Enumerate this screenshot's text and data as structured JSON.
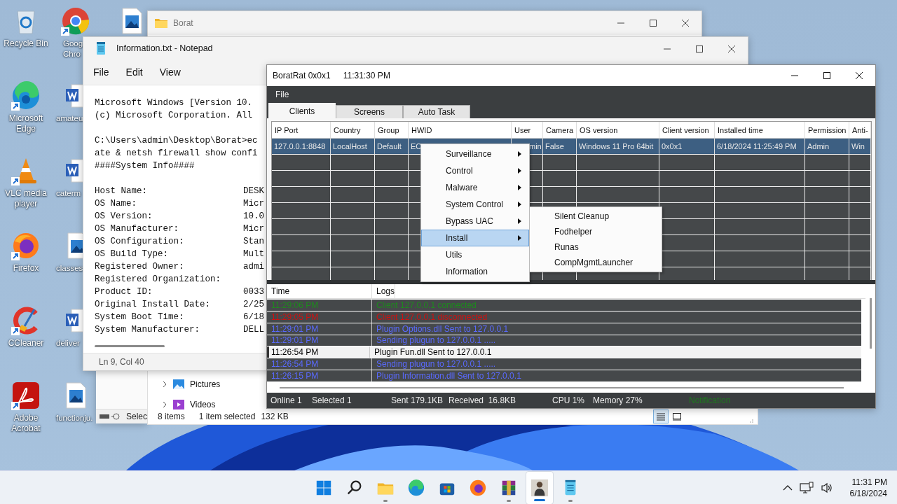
{
  "desktop_icons": [
    {
      "label": "Recycle Bin",
      "kind": "recycle_bin",
      "shortcut": false
    },
    {
      "label": "Goog Chro",
      "kind": "chrome",
      "shortcut": true
    },
    {
      "label": "Microsoft Edge",
      "kind": "edge",
      "shortcut": true
    },
    {
      "label": "amateu",
      "kind": "word",
      "shortcut": false
    },
    {
      "label": "VLC media player",
      "kind": "vlc",
      "shortcut": true
    },
    {
      "label": "caterm",
      "kind": "word",
      "shortcut": false
    },
    {
      "label": "Firefox",
      "kind": "firefox",
      "shortcut": true
    },
    {
      "label": "classes",
      "kind": "image",
      "shortcut": false
    },
    {
      "label": "CCleaner",
      "kind": "ccleaner",
      "shortcut": true
    },
    {
      "label": "deliver",
      "kind": "word",
      "shortcut": false
    },
    {
      "label": "Adobe Acrobat",
      "kind": "acrobat",
      "shortcut": true
    },
    {
      "label": "functionju.",
      "kind": "image",
      "shortcut": false
    }
  ],
  "hidden_desktop_icon": {
    "kind": "image"
  },
  "explorer": {
    "title": "Borat",
    "nav": [
      {
        "label": "Pictures",
        "kind": "pictures"
      },
      {
        "label": "Videos",
        "kind": "videos"
      }
    ],
    "status": {
      "items": "8 items",
      "selected": "1 item selected",
      "size": "132 KB"
    },
    "views": [
      {
        "kind": "details",
        "selected": true
      },
      {
        "kind": "tiles",
        "selected": false
      }
    ]
  },
  "back_window": {
    "status": "Selec"
  },
  "notepad": {
    "title": "Information.txt - Notepad",
    "menu": [
      "File",
      "Edit",
      "View"
    ],
    "paragraphs": [
      [
        "Microsoft Windows [Version 10.",
        "(c) Microsoft Corporation. All"
      ],
      [
        "C:\\Users\\admin\\Desktop\\Borat>ec",
        "ate & netsh firewall show confi",
        "####System Info####"
      ]
    ],
    "info": [
      {
        "label": "Host Name:",
        "value": "DESK"
      },
      {
        "label": "OS Name:",
        "value": "Micr"
      },
      {
        "label": "OS Version:",
        "value": "10.0"
      },
      {
        "label": "OS Manufacturer:",
        "value": "Micr"
      },
      {
        "label": "OS Configuration:",
        "value": "Stan"
      },
      {
        "label": "OS Build Type:",
        "value": "Mult"
      },
      {
        "label": "Registered Owner:",
        "value": "admi"
      },
      {
        "label": "Registered Organization:"
      },
      {
        "label": "Product ID:",
        "value": "0033"
      },
      {
        "label": "Original Install Date:",
        "value": "2/25"
      },
      {
        "label": "System Boot Time:",
        "value": "6/18"
      },
      {
        "label": "System Manufacturer:",
        "value": "DELL"
      }
    ],
    "status": "Ln 9, Col 40"
  },
  "boratrat": {
    "title": "BoratRat 0x0x1",
    "clock": "11:31:30 PM",
    "menu": [
      "File"
    ],
    "tabs": [
      {
        "label": "Clients",
        "selected": true
      },
      {
        "label": "Screens",
        "selected": false
      },
      {
        "label": "Auto Task",
        "selected": false
      }
    ],
    "clients": {
      "columns": [
        "IP Port",
        "Country",
        "Group",
        "HWID",
        "User",
        "Camera",
        "OS version",
        "Client version",
        "Installed time",
        "Permission",
        "Anti-"
      ],
      "rows": [
        {
          "selected": true,
          "cells": [
            "127.0.0.1:8848",
            "LocalHost",
            "Default",
            "EC",
            "min",
            "False",
            "Windows 11 Pro 64bit",
            "0x0x1",
            "6/18/2024 11:25:49 PM",
            "Admin",
            "Win"
          ]
        }
      ]
    },
    "context_menu": {
      "items": [
        {
          "label": "Surveillance",
          "submenu": true,
          "selected": false
        },
        {
          "label": "Control",
          "submenu": true,
          "selected": false
        },
        {
          "label": "Malware",
          "submenu": true,
          "selected": false
        },
        {
          "label": "System Control",
          "submenu": true,
          "selected": false
        },
        {
          "label": "Bypass UAC",
          "submenu": true,
          "selected": false
        },
        {
          "label": "Install",
          "submenu": true,
          "selected": true
        },
        {
          "label": "Utils",
          "submenu": false,
          "selected": false
        },
        {
          "label": "Information",
          "submenu": false,
          "selected": false
        }
      ],
      "submenu": [
        "Silent Cleanup",
        "Fodhelper",
        "Runas",
        "CompMgmtLauncher"
      ]
    },
    "logs": {
      "columns": [
        "Time",
        "Logs"
      ],
      "rows": [
        {
          "time": "11:29:06 PM",
          "message": "Client 127.0.0.1 connected",
          "color": "#1e8a1e",
          "selected": false
        },
        {
          "time": "11:29:05 PM",
          "message": "Client 127.0.0.1 disconnected",
          "color": "#d01010",
          "selected": false
        },
        {
          "time": "11:29:01 PM",
          "message": "Plugin Options.dll Sent to 127.0.0.1",
          "color": "#5a6aff",
          "selected": false
        },
        {
          "time": "11:29:01 PM",
          "message": "Sending plugun to 127.0.0.1 .....",
          "color": "#5a6aff",
          "selected": false
        },
        {
          "time": "11:26:54 PM",
          "message": "Plugin Fun.dll Sent to 127.0.0.1",
          "color": "#000000",
          "selected": true
        },
        {
          "time": "11:26:54 PM",
          "message": "Sending plugun to 127.0.0.1 .....",
          "color": "#5a6aff",
          "selected": false
        },
        {
          "time": "11:26:15 PM",
          "message": "Plugin Information.dll Sent to 127.0.0.1",
          "color": "#5a6aff",
          "selected": false
        }
      ]
    },
    "status": [
      "Online 1",
      "Selected 1",
      "Sent 179.1KB",
      "Received  16.8KB",
      "CPU 1%",
      "Memory 27%"
    ],
    "notification": {
      "label": "Notification",
      "color": "#1e7a1e"
    }
  },
  "taskbar": {
    "apps": [
      {
        "kind": "start",
        "running": false,
        "active": false
      },
      {
        "kind": "search",
        "running": false,
        "active": false
      },
      {
        "kind": "explorer",
        "running": true,
        "active": false
      },
      {
        "kind": "edge",
        "running": false,
        "active": false
      },
      {
        "kind": "store",
        "running": false,
        "active": false
      },
      {
        "kind": "firefox",
        "running": false,
        "active": false
      },
      {
        "kind": "winrar",
        "running": true,
        "active": false
      },
      {
        "kind": "figure",
        "running": true,
        "active": true
      },
      {
        "kind": "notepad",
        "running": true,
        "active": false
      }
    ],
    "time": "11:31 PM",
    "date": "6/18/2024"
  }
}
